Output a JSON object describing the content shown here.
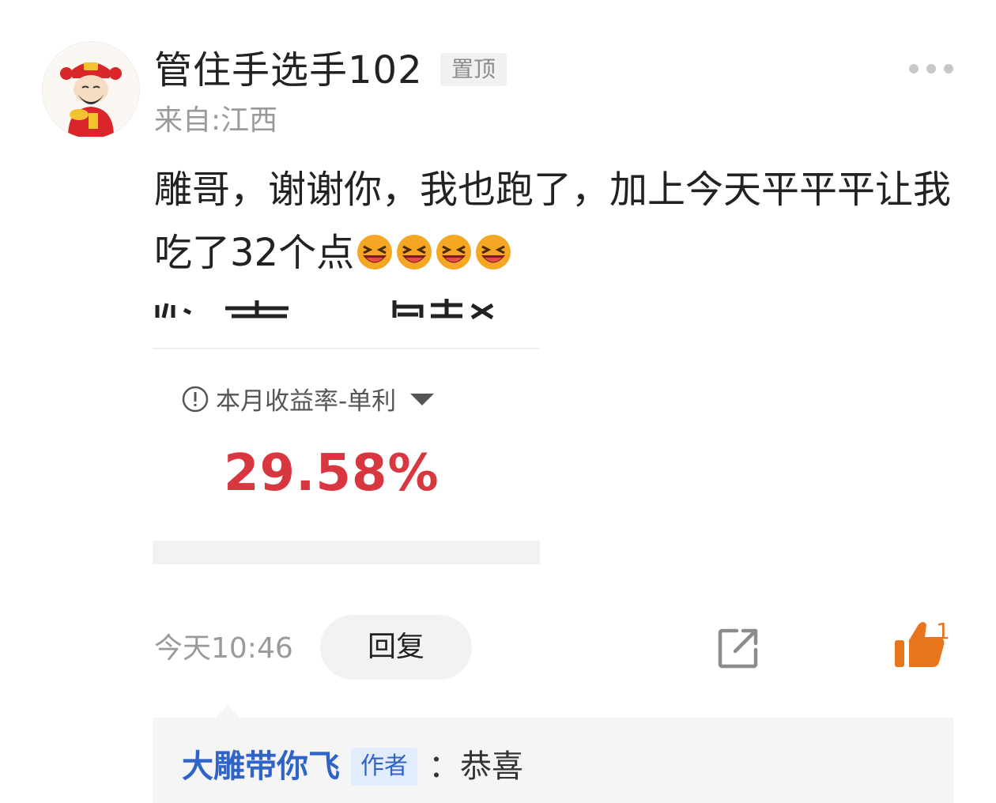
{
  "post": {
    "username": "管住手选手102",
    "pin_badge": "置顶",
    "location": "来自:江西",
    "text": "雕哥，谢谢你，我也跑了，加上今天平平平让我吃了32个点",
    "emoji_count": 4,
    "emoji_icon": "laughing-emoji-icon"
  },
  "embed_image": {
    "metric_label": "本月收益率-单利",
    "metric_value": "29.58%",
    "value_color": "#d9373f"
  },
  "actions": {
    "timestamp": "今天10:46",
    "reply_label": "回复",
    "like_count": "1",
    "like_color": "#e8741c"
  },
  "reply": {
    "author": "大雕带你飞",
    "badge": "作者",
    "separator": "：",
    "content": "恭喜",
    "author_color": "#2f64c8"
  }
}
